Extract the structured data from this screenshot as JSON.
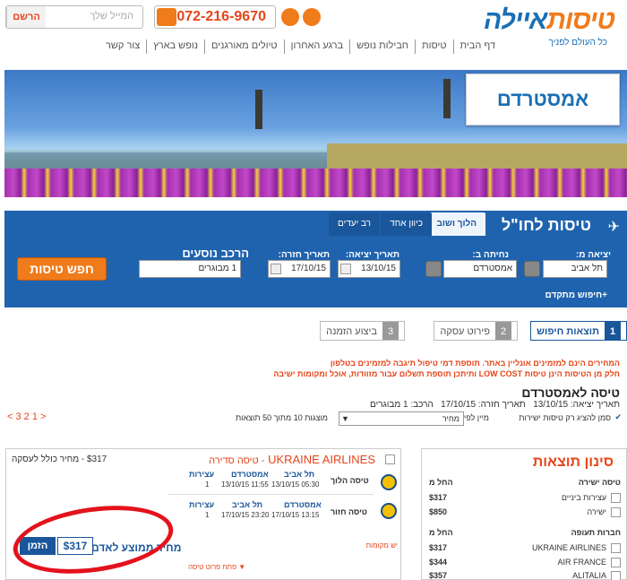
{
  "header": {
    "brand_main": "איילה",
    "brand_accent": "טיסות",
    "tagline": "כל העולם לפניך",
    "phone": "072-216-9670",
    "login_placeholder": "המייל שלך",
    "register_label": "הרשם"
  },
  "nav": [
    "דף הבית",
    "טיסות",
    "חבילות נופש",
    "ברגע האחרון",
    "טיולים מאורגנים",
    "נופש בארץ",
    "צור קשר"
  ],
  "banner": {
    "destination": "אמסטרדם"
  },
  "search": {
    "title": "טיסות לחו\"ל",
    "tabs": {
      "roundtrip": "הלוך ושוב",
      "oneway": "כיוון אחד",
      "multi": "רב יעדים"
    },
    "labels": {
      "from": "יציאה מ:",
      "to": "נחיתה ב:",
      "depart": "תאריך יציאה:",
      "return": "תאריך חזרה:",
      "pax": "הרכב נוסעים"
    },
    "values": {
      "from": "תל אביב",
      "to": "אמסטרדם",
      "depart": "13/10/15",
      "return": "17/10/15",
      "pax": "1 מבוגרים"
    },
    "button": "חפש טיסות",
    "advanced": "+חיפוש מתקדם"
  },
  "steps": [
    {
      "num": "1",
      "label": "תוצאות חיפוש"
    },
    {
      "num": "2",
      "label": "פירוט עסקה"
    },
    {
      "num": "3",
      "label": "ביצוע הזמנה"
    }
  ],
  "notices": {
    "line1": "המחירים הינם למזמינים אונליין באתר. תוספת דמי טיפול תיגבה למזמינים בטלפון",
    "line2": "חלק מן הטיסות הינן טיסות LOW COST ותיתכן תוספת תשלום עבור מזוודות, אוכל ומקומות ישיבה"
  },
  "results": {
    "title": "טיסה לאמסטרדם",
    "meta_depart": "תאריך יציאה: 13/10/15",
    "meta_return": "תאריך חזרה: 17/10/15",
    "meta_pax": "הרכב: 1 מבוגרים",
    "direct_only": "סמן להציג רק טיסות ישירות",
    "sort_label": "מיין לפי:",
    "sort_value": "מחיר",
    "count": "מוצגות 10 מתוך 50 תוצאות",
    "pages": "< 3 2 1 >"
  },
  "card": {
    "airline": "UKRAINE AIRLINES",
    "flight_type": "- טיסה סדירה",
    "price_note": "$317 - מחיר כולל לעסקה",
    "col_stops": "עצירות",
    "outbound": {
      "label": "טיסה הלוך",
      "from": "תל אביב",
      "from_time": "05:30 13/10/15",
      "to": "אמסטרדם",
      "to_time": "11:55 13/10/15",
      "stops": "1"
    },
    "inbound": {
      "label": "טיסה חזור",
      "from": "אמסטרדם",
      "from_time": "13:15 17/10/15",
      "to": "תל אביב",
      "to_time": "23:20 17/10/15",
      "stops": "1"
    },
    "stops_link": "יש מקומות",
    "avg_label": "מחיר ממוצע לאדם",
    "avg_price": "$317",
    "order_button": "הזמן",
    "details_link": "פתח פרוט טיסה"
  },
  "sidebar": {
    "title": "סינון תוצאות",
    "direct_head": "טיסה ישירה",
    "from_label": "החל מ",
    "stop_rows": [
      {
        "label": "עצירות ביניים",
        "price": "$317"
      },
      {
        "label": "ישירה",
        "price": "$850"
      }
    ],
    "airlines_head": "חברות תעופה",
    "airlines": [
      {
        "label": "UKRAINE AIRLINES",
        "price": "$317"
      },
      {
        "label": "AIR FRANCE",
        "price": "$344"
      },
      {
        "label": "ALITALIA",
        "price": "$357"
      }
    ]
  },
  "colors": {
    "brand_blue": "#1a6fb5",
    "accent_orange": "#f07b1a",
    "highlight_red": "#e3121c"
  }
}
